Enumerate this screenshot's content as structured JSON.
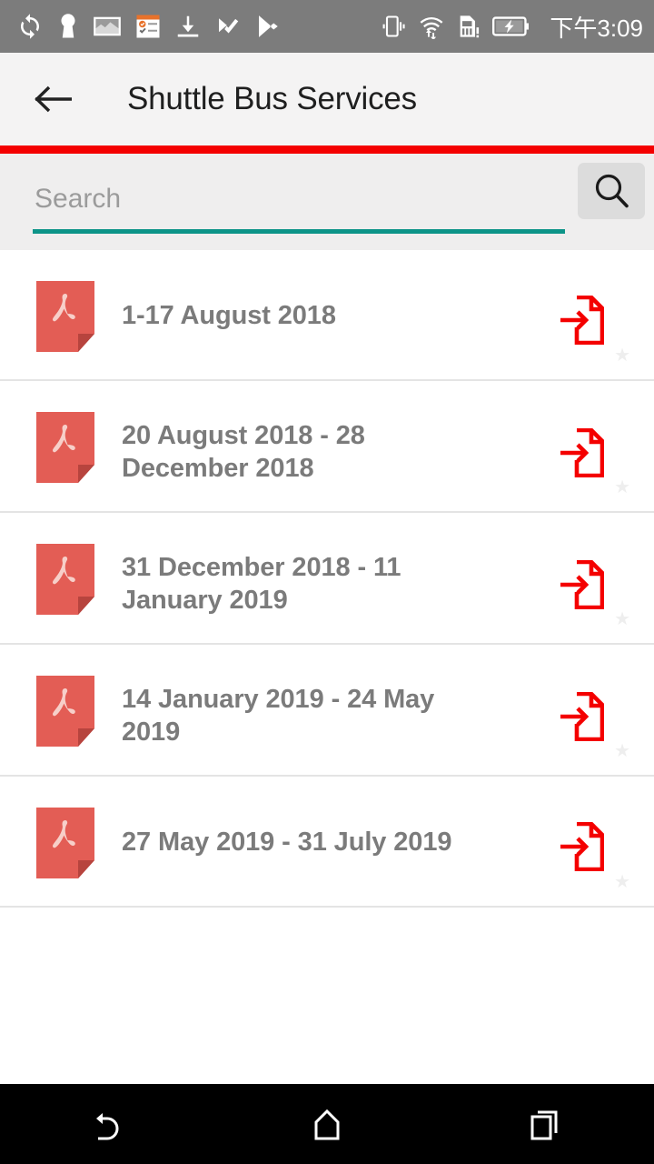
{
  "status_bar": {
    "time": "下午3:09",
    "background": "#7c7c7c",
    "left_icons": [
      "sync-icon",
      "keyhole-vpn-icon",
      "screenshot-image-icon",
      "checklist-icon",
      "download-icon",
      "check-play-icon",
      "play-store-icon"
    ],
    "right_icons": [
      "vibrate-icon",
      "wifi-data-icon",
      "sim-alert-icon",
      "battery-charging-icon"
    ]
  },
  "app_bar": {
    "back_label": "back",
    "title": "Shuttle Bus Services",
    "accent_color": "#f40000",
    "background": "#f4f3f3"
  },
  "search": {
    "value": "",
    "placeholder": "Search",
    "underline_color": "#0d9488",
    "button_label": "search"
  },
  "list": {
    "items": [
      {
        "title": "1-17 August 2018",
        "file_type": "pdf",
        "lines": 1
      },
      {
        "title": "20 August 2018 - 28 December 2018",
        "file_type": "pdf",
        "lines": 2
      },
      {
        "title": "31 December 2018 - 11 January 2019",
        "file_type": "pdf",
        "lines": 2
      },
      {
        "title": "14 January 2019 - 24 May 2019",
        "file_type": "pdf",
        "lines": 2
      },
      {
        "title": "27 May 2019 - 31 July 2019",
        "file_type": "pdf",
        "lines": 1
      }
    ],
    "open_icon": "open-document-icon",
    "favorite_icon": "star-icon",
    "text_color": "#7b7b7b"
  },
  "nav_bar": {
    "background": "#000000",
    "buttons": [
      "back-nav",
      "home-nav",
      "recents-nav"
    ]
  }
}
